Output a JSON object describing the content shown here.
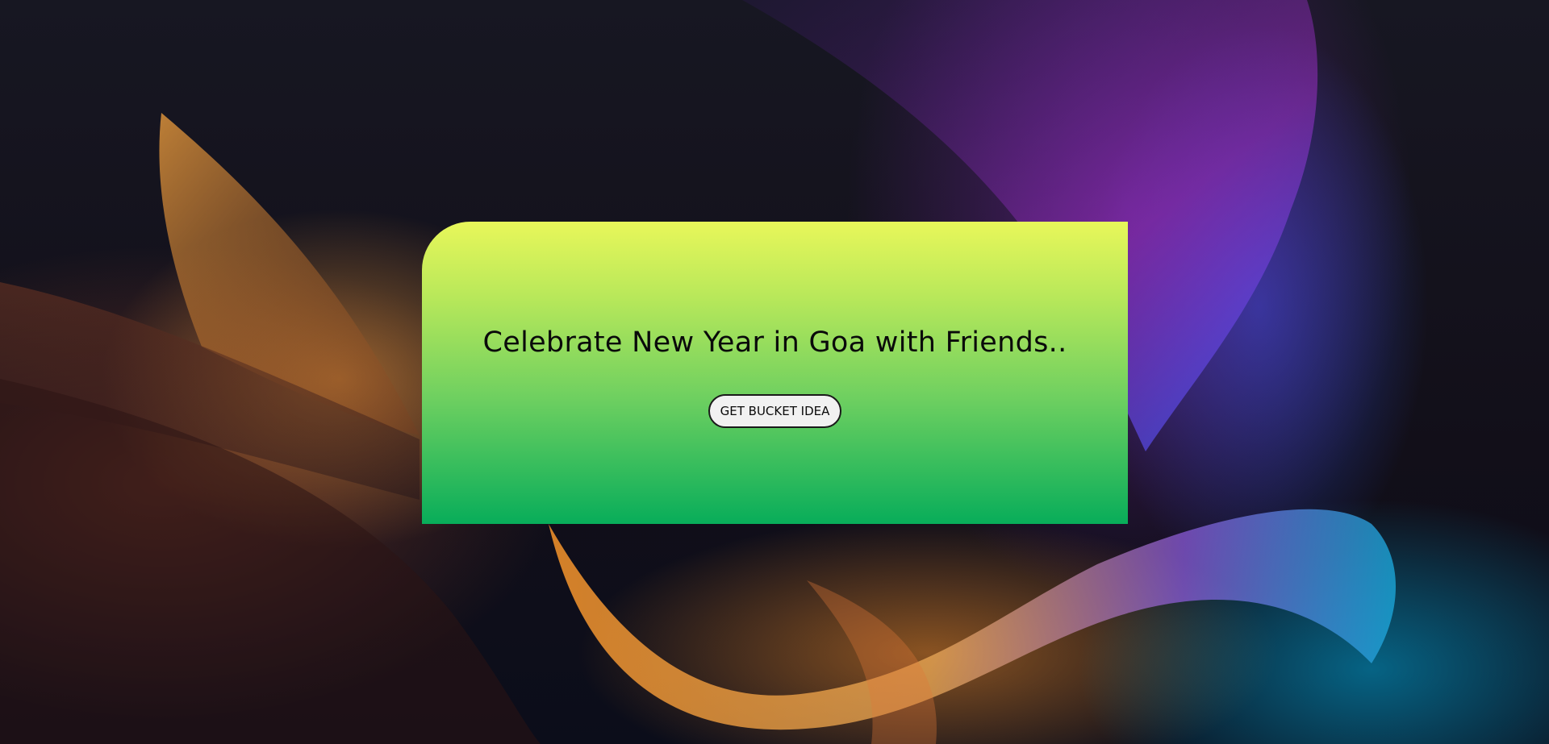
{
  "hero_card": {
    "title": "Celebrate New Year in Goa with Friends..",
    "button_label": "GET BUCKET IDEA"
  },
  "colors": {
    "card_gradient_top": "#e8f75a",
    "card_gradient_bottom": "#08ad5a",
    "button_background": "#f1f1f1",
    "text": "#0a0a0a"
  },
  "background": {
    "image": "abstract-wave-wallpaper"
  }
}
